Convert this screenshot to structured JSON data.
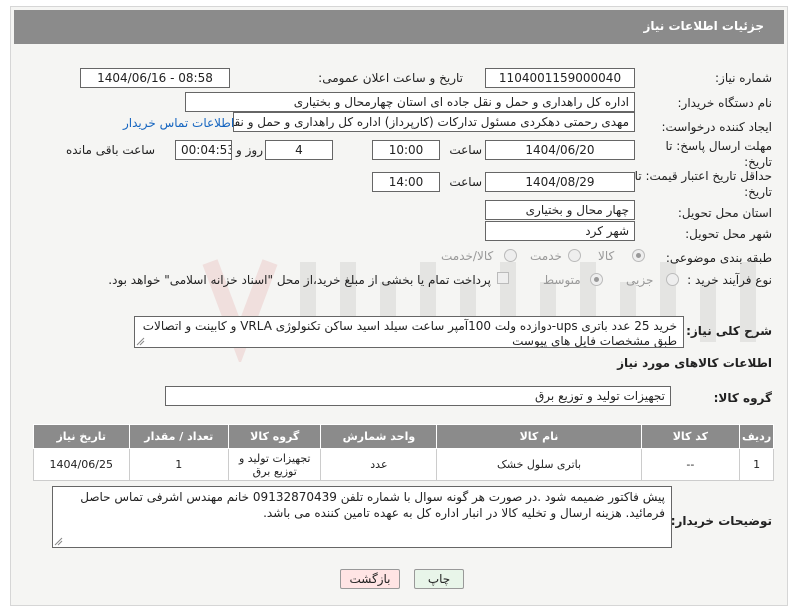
{
  "header": {
    "title": "جزئیات اطلاعات نیاز"
  },
  "fields": {
    "need_number_label": "شماره نیاز:",
    "need_number": "1104001159000040",
    "announce_label": "تاریخ و ساعت اعلان عمومی:",
    "announce_value": "1404/06/16 - 08:58",
    "buyer_org_label": "نام دستگاه خریدار:",
    "buyer_org": "اداره کل راهداری و حمل و نقل جاده ای استان چهارمحال و بختیاری",
    "creator_label": "ایجاد کننده درخواست:",
    "creator": "مهدی رحمتی دهکردی مسئول تدارکات (کارپرداز) اداره کل راهداری و حمل و نقل",
    "contact_link": "اطلاعات تماس خریدار",
    "deadline_label": "مهلت ارسال پاسخ: تا تاریخ:",
    "deadline_date": "1404/06/20",
    "time_label": "ساعت",
    "deadline_time": "10:00",
    "days_value": "4",
    "days_label": "روز و",
    "remaining_time": "00:04:53",
    "remaining_label": "ساعت باقی مانده",
    "min_validity_label": "حداقل تاریخ اعتبار قیمت: تا تاریخ:",
    "validity_date": "1404/08/29",
    "validity_time": "14:00",
    "province_label": "استان محل تحویل:",
    "province": "چهار محال و بختیاری",
    "city_label": "شهر محل تحویل:",
    "city": "شهر کرد",
    "category_label": "طبقه بندی موضوعی:",
    "category_options": [
      "کالا",
      "خدمت",
      "کالا/خدمت"
    ],
    "process_label": "نوع فرآیند خرید :",
    "process_options": [
      "جزیی",
      "متوسط"
    ],
    "payment_note": "پرداخت تمام یا بخشی از مبلغ خرید،از محل \"اسناد خزانه اسلامی\" خواهد بود.",
    "description_label": "شرح کلی نیاز:",
    "description": "خرید 25 عدد باتری ups-دوازده ولت 100آمپر ساعت سیلد اسید ساکن تکنولوژی VRLA  و کابینت و اتصالات طبق مشخصات فایل های پیوست",
    "goods_info_heading": "اطلاعات کالاهای مورد نیاز",
    "goods_group_label": "گروه کالا:",
    "goods_group": "تجهیزات تولید و توزیع برق",
    "buyer_notes_label": "توضیحات خریدار:",
    "buyer_notes": "پیش فاکتور ضمیمه شود .در صورت هر گونه سوال با شماره تلفن 09132870439 خانم مهندس اشرفی تماس حاصل فرمائید. هزینه ارسال و تخلیه کالا در انبار اداره کل به عهده تامین کننده می باشد."
  },
  "table": {
    "headers": [
      "ردیف",
      "کد کالا",
      "نام کالا",
      "واحد شمارش",
      "گروه کالا",
      "تعداد / مقدار",
      "تاریخ نیاز"
    ],
    "rows": [
      [
        "1",
        "--",
        "باتری سلول خشک",
        "عدد",
        "تجهیزات تولید و توزیع برق",
        "1",
        "1404/06/25"
      ]
    ]
  },
  "buttons": {
    "print": "چاپ",
    "back": "بازگشت"
  },
  "watermark": "AriaTender.net",
  "colors": {
    "header_bg": "#8b8b8b",
    "link": "#1565c0",
    "panel_bg": "#f5f5f3"
  }
}
